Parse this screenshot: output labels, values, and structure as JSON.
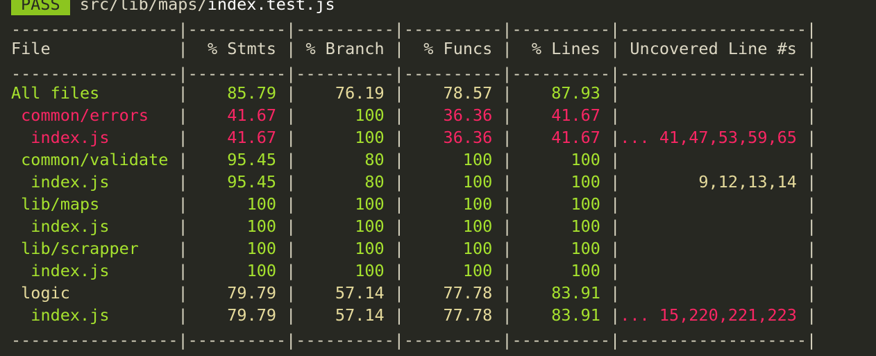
{
  "status": {
    "badge": "PASS",
    "path_dir": "src/lib/maps/",
    "path_file": "index.test.js"
  },
  "colors": {
    "ok": "#a6e22e",
    "medium": "#e6db9c",
    "low": "#f92664",
    "badge_bg": "#8cc51f",
    "background": "#272822"
  },
  "table": {
    "headers": [
      "File",
      "% Stmts",
      "% Branch",
      "% Funcs",
      "% Lines",
      "Uncovered Line #s"
    ],
    "rows": [
      {
        "file": "All files",
        "stmts": "85.79",
        "branch": "76.19",
        "funcs": "78.57",
        "lines": "87.93",
        "uncovered": ""
      },
      {
        "file": " common/errors",
        "stmts": "41.67",
        "branch": "100",
        "funcs": "36.36",
        "lines": "41.67",
        "uncovered": ""
      },
      {
        "file": "  index.js",
        "stmts": "41.67",
        "branch": "100",
        "funcs": "36.36",
        "lines": "41.67",
        "uncovered": "... 41,47,53,59,65"
      },
      {
        "file": " common/validate",
        "stmts": "95.45",
        "branch": "80",
        "funcs": "100",
        "lines": "100",
        "uncovered": ""
      },
      {
        "file": "  index.js",
        "stmts": "95.45",
        "branch": "80",
        "funcs": "100",
        "lines": "100",
        "uncovered": "9,12,13,14"
      },
      {
        "file": " lib/maps",
        "stmts": "100",
        "branch": "100",
        "funcs": "100",
        "lines": "100",
        "uncovered": ""
      },
      {
        "file": "  index.js",
        "stmts": "100",
        "branch": "100",
        "funcs": "100",
        "lines": "100",
        "uncovered": ""
      },
      {
        "file": " lib/scrapper",
        "stmts": "100",
        "branch": "100",
        "funcs": "100",
        "lines": "100",
        "uncovered": ""
      },
      {
        "file": "  index.js",
        "stmts": "100",
        "branch": "100",
        "funcs": "100",
        "lines": "100",
        "uncovered": ""
      },
      {
        "file": " logic",
        "stmts": "79.79",
        "branch": "57.14",
        "funcs": "77.78",
        "lines": "83.91",
        "uncovered": ""
      },
      {
        "file": "  index.js",
        "stmts": "79.79",
        "branch": "57.14",
        "funcs": "77.78",
        "lines": "83.91",
        "uncovered": "... 15,220,221,223"
      }
    ],
    "row_colors": [
      {
        "file": "ok",
        "stmts": "ok",
        "branch": "mid",
        "funcs": "mid",
        "lines": "ok",
        "uncovered": "mid"
      },
      {
        "file": "bad",
        "stmts": "bad",
        "branch": "ok",
        "funcs": "bad",
        "lines": "bad",
        "uncovered": "bad"
      },
      {
        "file": "bad",
        "stmts": "bad",
        "branch": "ok",
        "funcs": "bad",
        "lines": "bad",
        "uncovered": "bad"
      },
      {
        "file": "ok",
        "stmts": "ok",
        "branch": "ok",
        "funcs": "ok",
        "lines": "ok",
        "uncovered": "mid"
      },
      {
        "file": "ok",
        "stmts": "ok",
        "branch": "ok",
        "funcs": "ok",
        "lines": "ok",
        "uncovered": "mid"
      },
      {
        "file": "ok",
        "stmts": "ok",
        "branch": "ok",
        "funcs": "ok",
        "lines": "ok",
        "uncovered": "mid"
      },
      {
        "file": "ok",
        "stmts": "ok",
        "branch": "ok",
        "funcs": "ok",
        "lines": "ok",
        "uncovered": "mid"
      },
      {
        "file": "ok",
        "stmts": "ok",
        "branch": "ok",
        "funcs": "ok",
        "lines": "ok",
        "uncovered": "mid"
      },
      {
        "file": "ok",
        "stmts": "ok",
        "branch": "ok",
        "funcs": "ok",
        "lines": "ok",
        "uncovered": "mid"
      },
      {
        "file": "mid",
        "stmts": "mid",
        "branch": "mid",
        "funcs": "mid",
        "lines": "ok",
        "uncovered": "mid"
      },
      {
        "file": "ok",
        "stmts": "mid",
        "branch": "mid",
        "funcs": "mid",
        "lines": "ok",
        "uncovered": "bad"
      }
    ]
  }
}
